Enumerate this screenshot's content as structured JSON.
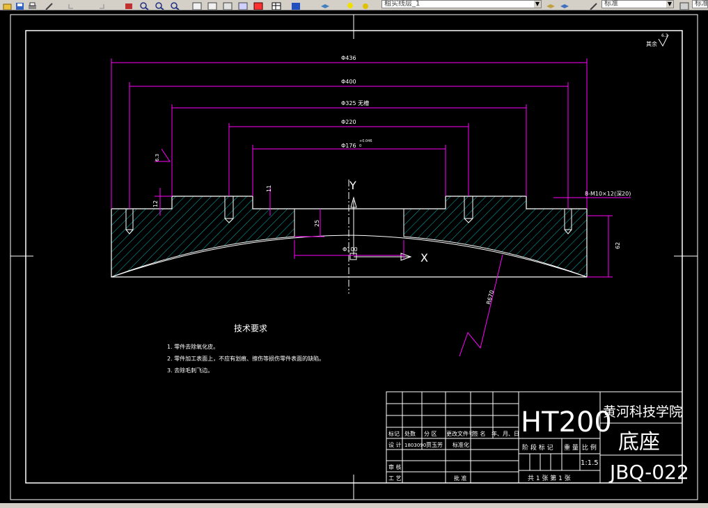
{
  "toolbar": {
    "layer_name": "粗实线层_1",
    "style_name": "标准",
    "style_name_2": "标准",
    "dropdown_glyph": "▼"
  },
  "drawing": {
    "surface_mark": "其余",
    "surface_value": "6.3",
    "dims": {
      "d436": "Φ436",
      "d400": "Φ400",
      "d325": "Φ325 无槽",
      "d220": "Φ220",
      "d176": "Φ176",
      "d176_tol": "+0.046",
      "d176_tol2": "0",
      "d100": "Φ100",
      "h12": "12",
      "h11": "11",
      "h25": "25",
      "h62": "62",
      "r670": "R670",
      "rough_left": "6.3",
      "holes": "8-M10×12(深20)"
    },
    "axis_y": "Y",
    "axis_x": "X"
  },
  "requirements": {
    "title": "技术要求",
    "items": [
      "1. 零件去除氧化皮。",
      "2. 零件加工表面上，不应有划痕、擦伤等损伤零件表面的缺陷。",
      "3. 去除毛刺飞边。"
    ]
  },
  "title_block": {
    "material": "HT200",
    "school": "黄河科技学院",
    "part_name": "底座",
    "drawing_no": "JBQ-022",
    "col_headers": [
      "标记",
      "处数",
      "分 区",
      "更改文件号",
      "签 名",
      "年、月、日"
    ],
    "design_label": "设 计",
    "design_no": "1803090",
    "designer": "贾玉芳",
    "standardize": "标准化",
    "stage_label": "阶 段 标 记",
    "weight_label": "重 量",
    "scale_label": "比 例",
    "scale_value": "1:1.5",
    "review_label": "审 核",
    "process_label": "工 艺",
    "approve_label": "批 准",
    "sheets": "共 1  张   第  1 张"
  }
}
